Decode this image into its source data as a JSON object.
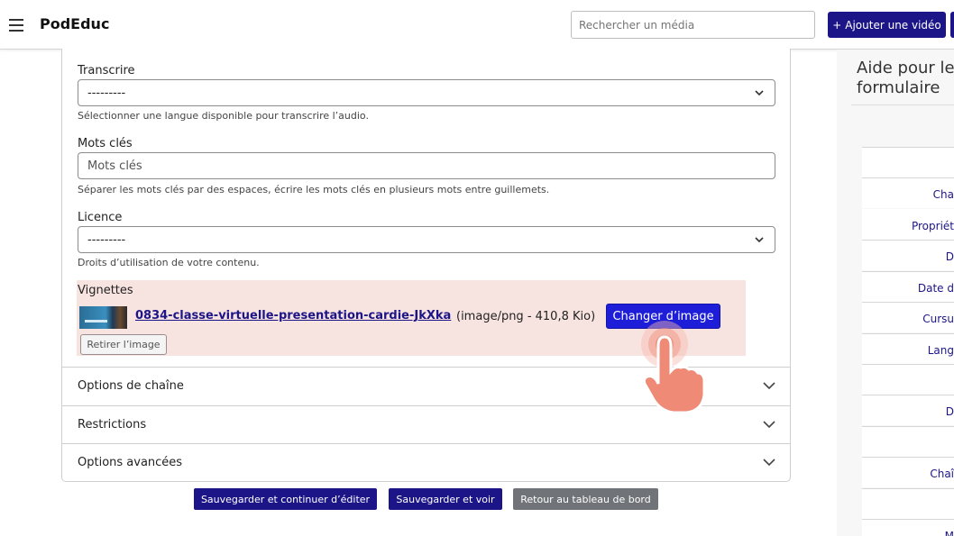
{
  "header": {
    "brand": "PodEduc",
    "search_placeholder": "Rechercher un média",
    "add_video_label": "Ajouter une vidéo"
  },
  "form": {
    "transcribe": {
      "label": "Transcrire",
      "value": "---------",
      "help": "Sélectionner une langue disponible pour transcrire l’audio."
    },
    "keywords": {
      "label": "Mots clés",
      "placeholder": "Mots clés",
      "help": "Séparer les mots clés par des espaces, écrire les mots clés en plusieurs mots entre guillemets."
    },
    "license": {
      "label": "Licence",
      "value": "---------",
      "help": "Droits d’utilisation de votre contenu."
    },
    "thumbnails": {
      "label": "Vignettes",
      "filename": "0834-classe-virtuelle-presentation-cardie-JkXka",
      "meta": "(image/png - 410,8 Kio)",
      "change_label": "Changer d’image",
      "remove_label": "Retirer l’image"
    },
    "accordions": [
      {
        "label": "Options de chaîne"
      },
      {
        "label": "Restrictions"
      },
      {
        "label": "Options avancées"
      }
    ]
  },
  "actions": {
    "save_continue": "Sauvegarder et continuer d’éditer",
    "save_view": "Sauvegarder et voir",
    "back_dashboard": "Retour au tableau de bord"
  },
  "help_panel": {
    "title": "Aide pour le\nformulaire",
    "items": [
      "",
      "Cha",
      "",
      "Propriét",
      "D",
      "Date d",
      "Cursu",
      "Lang",
      "",
      "D",
      "",
      "Chaî",
      "",
      "M"
    ]
  },
  "colors": {
    "primary": "#1c1587",
    "thumbnail_bg": "#f7e3e0",
    "change_button": "#1e1ed8",
    "grey_button": "#707478"
  }
}
